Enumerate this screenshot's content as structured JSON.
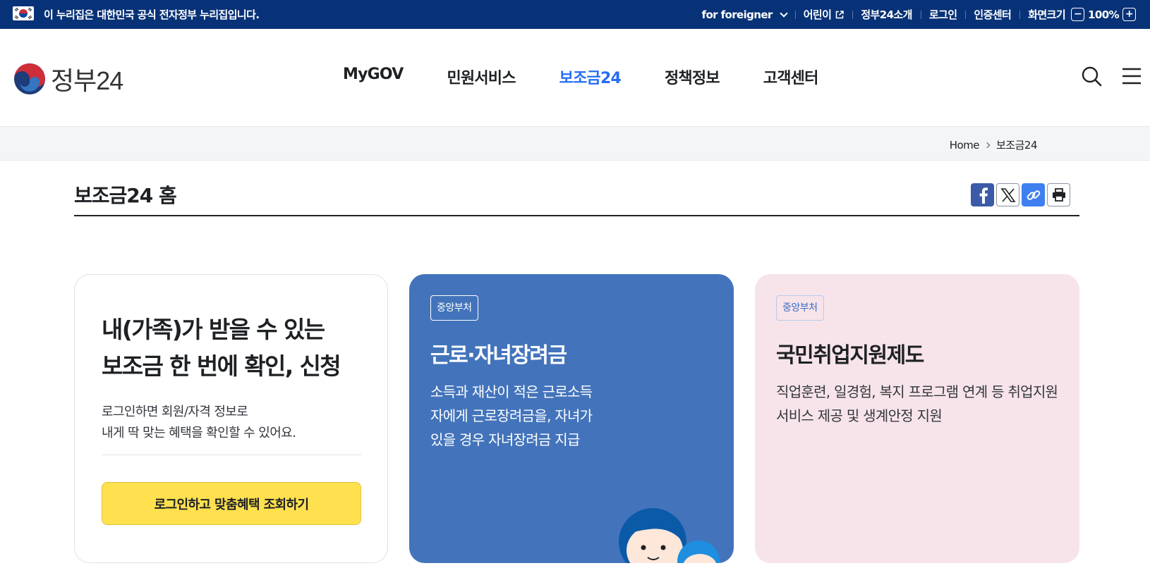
{
  "gov_banner": {
    "text": "이 누리집은 대한민국 공식 전자정부 누리집입니다.",
    "links": {
      "foreigner": "for foreigner",
      "kids": "어린이",
      "about": "정부24소개",
      "login": "로그인",
      "cert": "인증센터",
      "zoom_label": "화면크기",
      "zoom_minus": "−",
      "zoom_value": "100%",
      "zoom_plus": "+"
    }
  },
  "header": {
    "logo_text": "정부24",
    "nav": [
      "MyGOV",
      "민원서비스",
      "보조금24",
      "정책정보",
      "고객센터"
    ],
    "active_nav": "보조금24"
  },
  "breadcrumb": {
    "home": "Home",
    "current": "보조금24"
  },
  "page": {
    "title": "보조금24 홈"
  },
  "cards": {
    "login": {
      "heading_line1": "내(가족)가 받을 수 있는",
      "heading_line2": "보조금 한 번에 확인, 신청",
      "desc_line1": "로그인하면 회원/자격 정보로",
      "desc_line2": "내게 딱 맞는 혜택을 확인할 수 있어요.",
      "button": "로그인하고 맞춤혜택 조회하기"
    },
    "benefit1": {
      "tag": "중앙부처",
      "title": "근로·자녀장려금",
      "desc": "소득과 재산이 적은 근로소득자에게 근로장려금을, 자녀가 있을 경우 자녀장려금 지급"
    },
    "benefit2": {
      "tag": "중앙부처",
      "title": "국민취업지원제도",
      "desc": "직업훈련, 일경험, 복지 프로그램 연계 등 취업지원서비스 제공 및 생계안정 지원"
    }
  },
  "colors": {
    "gov_bar": "#083277",
    "accent": "#256ef4",
    "blue_card": "#4374bb",
    "pink_card": "#f7e4ea",
    "login_button": "#ffe04f"
  }
}
